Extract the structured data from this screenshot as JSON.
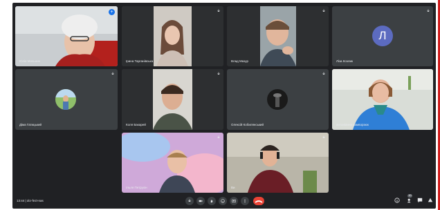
{
  "participants": [
    {
      "name": "Юлія Мельник",
      "pinned": true
    },
    {
      "name": "Ірина Тарганівська"
    },
    {
      "name": "Влад Мазур"
    },
    {
      "name": "Ліза Козлик",
      "initial": "Л"
    },
    {
      "name": "Діма Гатицький"
    },
    {
      "name": "Коля Бакарей"
    },
    {
      "name": "Олексій Кобилянський"
    },
    {
      "name": "антоніанна вамворзюк"
    },
    {
      "name": "Ільля Петрухін"
    },
    {
      "name": "Ви"
    }
  ],
  "meeting": {
    "time": "13:44",
    "separator": "|",
    "code": "dcr-fezt-nas",
    "people_count": "10"
  },
  "colors": {
    "accent": "#1a73e8",
    "end_call": "#ea4335",
    "background": "#202124",
    "tile": "#3c4043"
  }
}
